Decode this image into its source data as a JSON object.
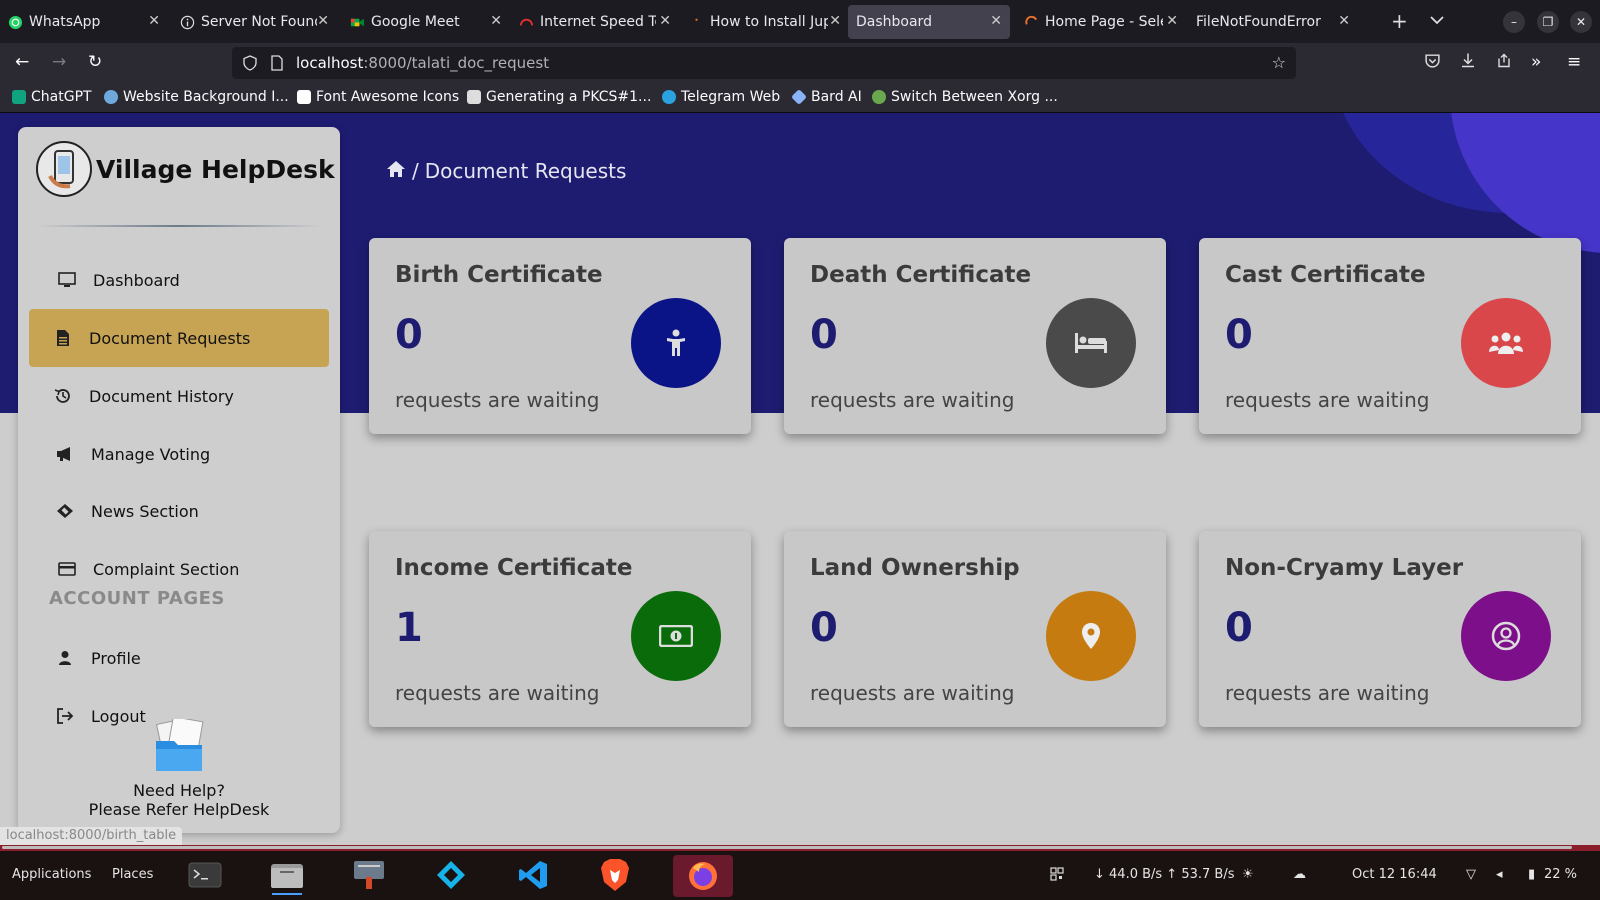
{
  "browser": {
    "tabs": [
      {
        "title": "WhatsApp",
        "icon": "whatsapp-icon"
      },
      {
        "title": "Server Not Found",
        "icon": "info-icon"
      },
      {
        "title": "Google Meet",
        "icon": "google-meet-icon"
      },
      {
        "title": "Internet Speed Test",
        "icon": "speedtest-icon"
      },
      {
        "title": "How to Install Jupyter",
        "icon": "spinner-icon"
      },
      {
        "title": "Dashboard",
        "icon": ""
      },
      {
        "title": "Home Page - Selenium",
        "icon": "selenium-icon"
      },
      {
        "title": "FileNotFoundError at",
        "icon": ""
      }
    ],
    "active_tab_index": 5,
    "url_host": "localhost",
    "url_path": ":8000/talati_doc_request",
    "bookmarks": [
      {
        "label": "ChatGPT",
        "color": "#10a37f"
      },
      {
        "label": "Website Background I...",
        "color": "#6fa8dc"
      },
      {
        "label": "Font Awesome Icons",
        "color": "#ffffff"
      },
      {
        "label": "Generating a PKCS#1...",
        "color": "#dddddd"
      },
      {
        "label": "Telegram Web",
        "color": "#2aa3e0"
      },
      {
        "label": "Bard AI",
        "color": "#8ab4f8"
      },
      {
        "label": "Switch Between Xorg ...",
        "color": "#6aa84f"
      }
    ]
  },
  "app": {
    "brand": "Village HelpDesk",
    "breadcrumb": "Document Requests",
    "menu": [
      {
        "label": "Dashboard",
        "icon": "monitor-icon",
        "active": false
      },
      {
        "label": "Document Requests",
        "icon": "document-icon",
        "active": true
      },
      {
        "label": "Document History",
        "icon": "history-icon",
        "active": false
      },
      {
        "label": "Manage Voting",
        "icon": "megaphone-icon",
        "active": false
      },
      {
        "label": "News Section",
        "icon": "ticket-icon",
        "active": false
      },
      {
        "label": "Complaint Section",
        "icon": "credit-card-icon",
        "active": false
      }
    ],
    "account_label": "ACCOUNT PAGES",
    "account_menu": [
      {
        "label": "Profile",
        "icon": "user-icon"
      },
      {
        "label": "Logout",
        "icon": "logout-icon"
      }
    ],
    "help_line1": "Need Help?",
    "help_line2": "Please Refer HelpDesk",
    "cards": [
      {
        "title": "Birth Certificate",
        "count": "0",
        "subtitle": "requests are waiting",
        "icon": "child-icon",
        "color": "#0b1486"
      },
      {
        "title": "Death Certificate",
        "count": "0",
        "subtitle": "requests are waiting",
        "icon": "bed-icon",
        "color": "#4a4a4a"
      },
      {
        "title": "Cast Certificate",
        "count": "0",
        "subtitle": "requests are waiting",
        "icon": "users-icon",
        "color": "#d9474b"
      },
      {
        "title": "Income Certificate",
        "count": "1",
        "subtitle": "requests are waiting",
        "icon": "money-icon",
        "color": "#0a6b0a"
      },
      {
        "title": "Land Ownership",
        "count": "0",
        "subtitle": "requests are waiting",
        "icon": "map-pin-icon",
        "color": "#c57b10"
      },
      {
        "title": "Non-Cryamy Layer",
        "count": "0",
        "subtitle": "requests are waiting",
        "icon": "user-circle-icon",
        "color": "#7d0f8a"
      }
    ],
    "status_link": "localhost:8000/birth_table"
  },
  "taskbar": {
    "applications": "Applications",
    "places": "Places",
    "network": "↓ 44.0 B/s ↑ 53.7 B/s",
    "datetime": "Oct 12  16:44",
    "battery": "22 %"
  }
}
